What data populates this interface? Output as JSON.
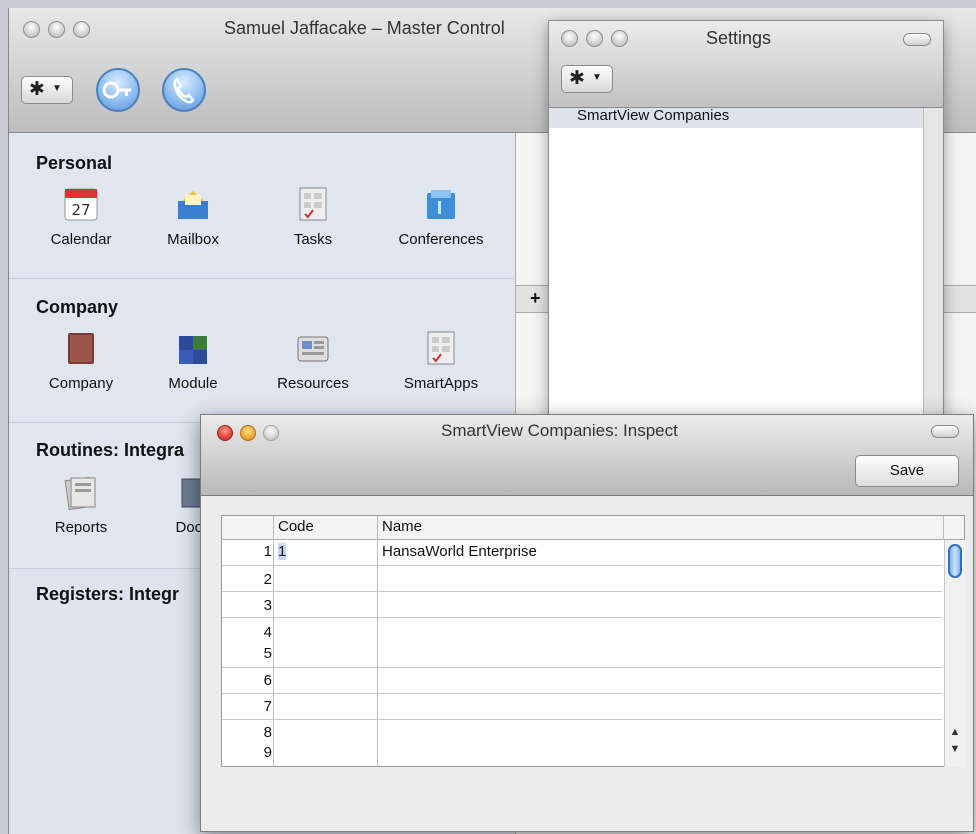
{
  "master": {
    "title": "Samuel Jaffacake – Master Control",
    "sections": [
      {
        "title": "Personal",
        "items": [
          {
            "label": "Calendar",
            "icon": "calendar-icon",
            "badge": "27"
          },
          {
            "label": "Mailbox",
            "icon": "mailbox-icon"
          },
          {
            "label": "Tasks",
            "icon": "tasks-icon"
          },
          {
            "label": "Conferences",
            "icon": "conferences-icon"
          }
        ]
      },
      {
        "title": "Company",
        "items": [
          {
            "label": "Company",
            "icon": "company-book-icon"
          },
          {
            "label": "Module",
            "icon": "module-puzzle-icon"
          },
          {
            "label": "Resources",
            "icon": "resources-icon"
          },
          {
            "label": "SmartApps",
            "icon": "smartapps-icon"
          }
        ]
      },
      {
        "title": "Routines: Integra",
        "items": [
          {
            "label": "Reports",
            "icon": "reports-icon"
          },
          {
            "label": "Docu",
            "icon": "documents-icon"
          }
        ]
      },
      {
        "title": "Registers: Integr",
        "items": []
      }
    ],
    "plus_label": "+"
  },
  "settings": {
    "title": "Settings",
    "list_header": "SmartView Companies"
  },
  "inspect": {
    "title": "SmartView Companies: Inspect",
    "save_label": "Save",
    "columns": [
      "Code",
      "Name"
    ],
    "rows": [
      {
        "n": "1",
        "code": "1",
        "name": "HansaWorld Enterprise"
      },
      {
        "n": "2",
        "code": "",
        "name": ""
      },
      {
        "n": "3",
        "code": "",
        "name": ""
      },
      {
        "n": "4",
        "code": "",
        "name": ""
      },
      {
        "n": "5",
        "code": "",
        "name": ""
      },
      {
        "n": "6",
        "code": "",
        "name": ""
      },
      {
        "n": "7",
        "code": "",
        "name": ""
      },
      {
        "n": "8",
        "code": "",
        "name": ""
      },
      {
        "n": "9",
        "code": "",
        "name": ""
      }
    ]
  },
  "colors": {
    "sidebar": "#dfe6f0",
    "accent": "#2f6fc4",
    "close": "#e0413a",
    "minimize": "#f0a530"
  }
}
